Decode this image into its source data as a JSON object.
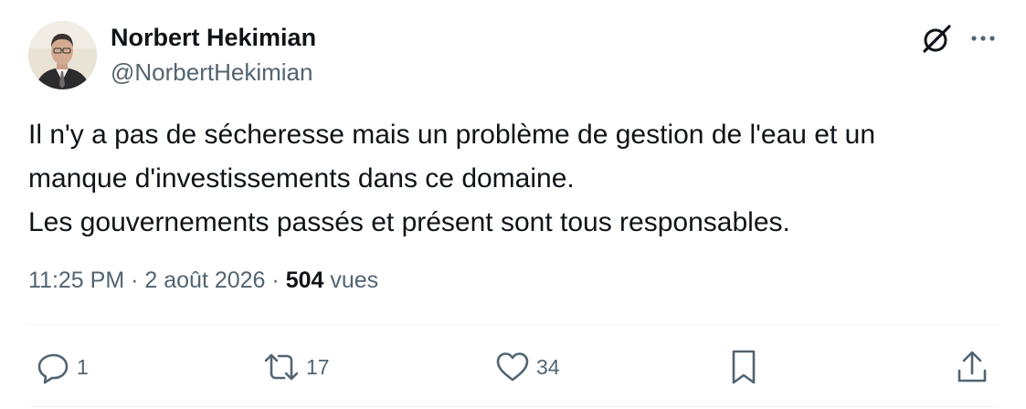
{
  "author": {
    "name": "Norbert Hekimian",
    "handle": "@NorbertHekimian"
  },
  "tweet": {
    "text": "Il n'y a pas de sécheresse mais un problème de gestion de l'eau et un\nmanque d'investissements dans ce domaine.\nLes gouvernements passés et présent sont tous responsables."
  },
  "meta": {
    "time": "11:25 PM",
    "separator": "·",
    "date": "2 août 2026",
    "views_count": "504",
    "views_label": "vues"
  },
  "actions": {
    "replies": "1",
    "retweets": "17",
    "likes": "34"
  },
  "icons": {
    "header": [
      "grok-icon",
      "more-icon"
    ],
    "actions": [
      "reply-icon",
      "retweet-icon",
      "like-icon",
      "bookmark-icon",
      "share-icon"
    ]
  },
  "colors": {
    "text": "#0f1419",
    "secondary": "#536471",
    "divider": "#eff3f4"
  }
}
